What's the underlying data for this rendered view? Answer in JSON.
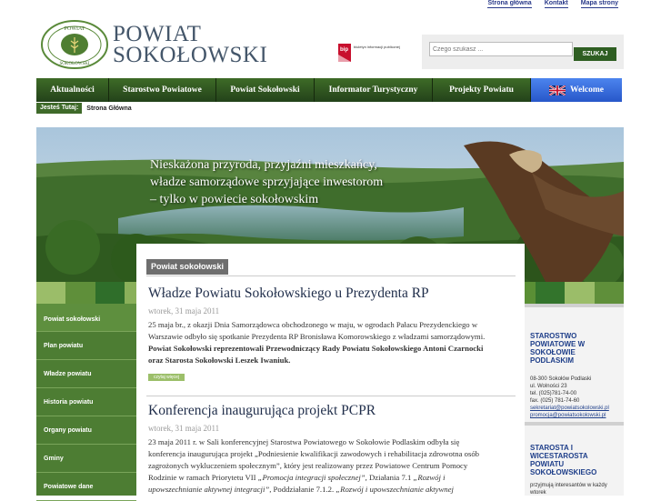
{
  "top_links": [
    "Strona główna",
    "Kontakt",
    "Mapa strony"
  ],
  "logo": {
    "ring_top": "POWIAT",
    "ring_bottom": "SOKOŁOWSKI"
  },
  "site_title": {
    "line1": "POWIAT",
    "line2": "SOKOŁOWSKI"
  },
  "bip": {
    "mark": "bip",
    "caption": "biuletyn informacji publicznej"
  },
  "search": {
    "placeholder": "Czego szukasz ...",
    "button": "SZUKAJ"
  },
  "nav": [
    {
      "label": "Aktualności"
    },
    {
      "label": "Starostwo Powiatowe"
    },
    {
      "label": "Powiat Sokołowski"
    },
    {
      "label": "Informator Turystyczny"
    },
    {
      "label": "Projekty Powiatu"
    },
    {
      "label": "Welcome"
    }
  ],
  "breadcrumb": {
    "label": "Jesteś Tutaj:",
    "current": "Strona Główna"
  },
  "banner": {
    "line1": "Nieskażona przyroda, przyjaźni mieszkańcy,",
    "line2": "władze samorządowe sprzyjające inwestorom",
    "line3": "– tylko w powiecie sokołowskim"
  },
  "left_menu": [
    "Powiat sokołowski",
    "Plan powiatu",
    "Władze powiatu",
    "Historia powiatu",
    "Organy powiatu",
    "Gminy",
    "Powiatowe dane"
  ],
  "main": {
    "section_title": "Powiat sokołowski",
    "articles": [
      {
        "title": "Władze Powiatu Sokołowskiego u Prezydenta RP",
        "date": "wtorek, 31 maja 2011",
        "p1": "25 maja br., z okazji Dnia Samorządowca obchodzonego w maju, w ogrodach Pałacu Prezydenckiego w Warszawie odbyło się spotkanie Prezydenta RP Bronisława Komorowskiego z władzami samorządowymi.",
        "p2": "Powiat Sokołowski reprezentowali Przewodniczący Rady Powiatu Sokołowskiego Antoni Czarnocki oraz Starosta Sokołowski Leszek Iwaniuk.",
        "more": "czytaj więcej"
      },
      {
        "title": "Konferencja inaugurująca projekt PCPR",
        "date": "wtorek, 31 maja 2011",
        "p1": "23 maja 2011 r. w Sali konferencyjnej Starostwa Powiatowego w Sokołowie Podlaskim odbyła się konferencja inaugurująca projekt „Podniesienie kwalifikacji zawodowych i rehabilitacja zdrowotna osób zagrożonych wykluczeniem społecznym”, który jest realizowany przez Powiatowe Centrum Pomocy Rodzinie w ramach Priorytetu VII",
        "i1": "„Promocja integracji społecznej”",
        "t2": ", Działania 7.1",
        "i2": "„Rozwój i upowszechnianie aktywnej integracji”",
        "t3": ", Poddziałanie 7.1.2.",
        "i3": "„Rozwój i upowszechnianie aktywnej"
      }
    ]
  },
  "right": {
    "box1": {
      "title": "STAROSTWO POWIATOWE W SOKOŁOWIE PODLASKIM",
      "addr1": "08-300 Sokołów Podlaski",
      "addr2": "ul. Wolności 23",
      "tel": "tel. (025)781-74-00",
      "fax": "fax. (025) 781-74-60",
      "email1": "sekretariat@powiatsokolowski.pl",
      "email2": "promocja@powiatsokolowski.pl"
    },
    "box2": {
      "title": "STAROSTA I WICESTAROSTA POWIATU SOKOŁOWSKIEGO",
      "text": "przyjmują interesantów w każdy wtorek"
    }
  }
}
